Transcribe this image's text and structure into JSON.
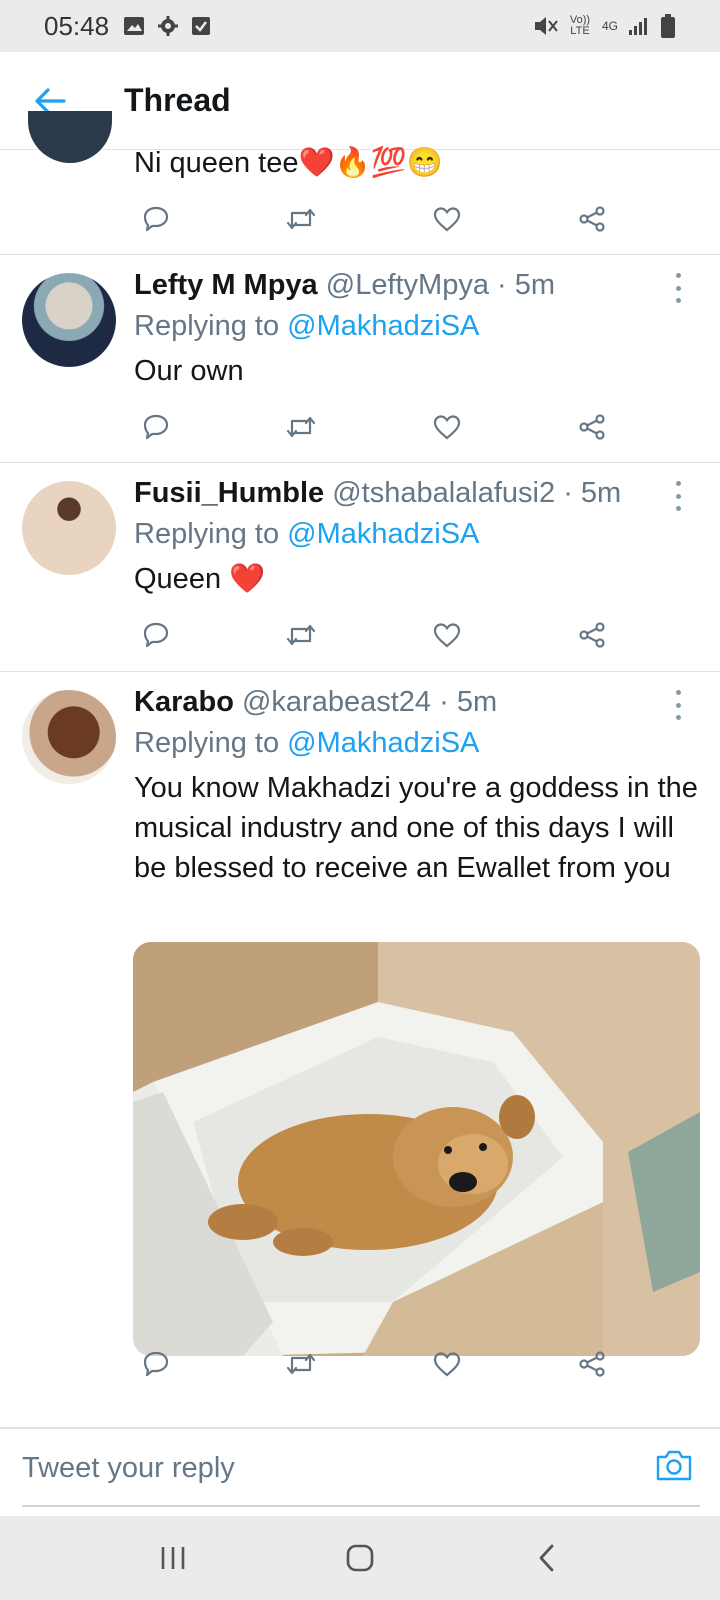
{
  "status_bar": {
    "time": "05:48",
    "left_icons": [
      "image-icon",
      "gear-icon",
      "checkbox-icon"
    ],
    "right_icons": [
      "mute-icon",
      "volte-icon",
      "4g-icon",
      "signal-icon",
      "battery-icon"
    ],
    "volte_label": "Vo)) LTE",
    "network_label": "4G"
  },
  "header": {
    "title": "Thread"
  },
  "tweets": [
    {
      "text": "Ni queen tee❤️🔥💯😁"
    },
    {
      "name": "Lefty M Mpya",
      "handle": "@LeftyMpya",
      "time": "· 5m",
      "replying_prefix": "Replying to",
      "replying_to": "@MakhadziSA",
      "text": "Our own"
    },
    {
      "name": "Fusii_Humble",
      "handle": "@tshabalalafusi2",
      "time": "· 5m",
      "replying_prefix": "Replying to",
      "replying_to": "@MakhadziSA",
      "text": "Queen ❤️"
    },
    {
      "name": "Karabo",
      "handle": "@karabeast24",
      "time": "· 5m",
      "replying_prefix": "Replying to",
      "replying_to": "@MakhadziSA",
      "text": "You know Makhadzi you're a goddess in the musical industry and one of this days I will be blessed to receive an Ewallet from you"
    }
  ],
  "composer": {
    "placeholder": "Tweet your reply"
  },
  "colors": {
    "accent": "#1da1f2",
    "text": "#14171a",
    "secondary": "#657786",
    "divider": "#dfe3e6"
  }
}
